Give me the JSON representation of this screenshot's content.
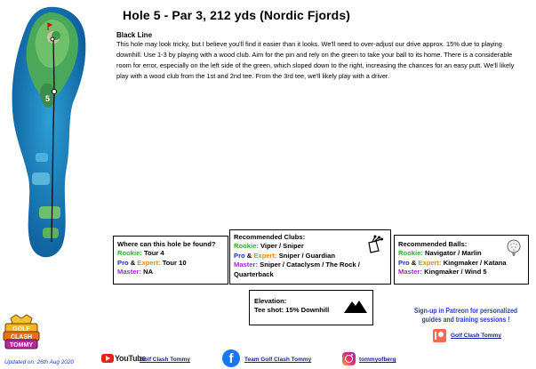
{
  "title": "Hole 5 - Par 3, 212 yds (Nordic Fjords)",
  "line_name": "Black Line",
  "description": "This hole may look tricky, but I believe you'll find it easier than it looks. We'll need to over-adjust our drive approx. 15% due to playing downhill. Use 1-3 by playing with a wood club. Aim for the pin and rely on the green to take your ball to its home. There is a considerable room for error, especially on the left side of the green, which sloped down to the right, increasing the chances for an easy putt. We'll likely play with a wood club from the 1st and 2nd tee. From the 3rd tee, we'll likely play with a driver.",
  "where": {
    "heading": "Where can this hole be found?",
    "rookie_label": "Rookie:",
    "rookie_value": "Tour 4",
    "pro_label": "Pro",
    "and_text": "&",
    "expert_label": "Expert:",
    "pro_expert_value": "Tour 10",
    "master_label": "Master:",
    "master_value": "NA"
  },
  "clubs": {
    "heading": "Recommended Clubs:",
    "rookie_label": "Rookie:",
    "rookie_value": "Viper / Sniper",
    "pro_label": "Pro",
    "and_text": "&",
    "expert_label": "Expert:",
    "pro_expert_value": "Sniper / Guardian",
    "master_label": "Master:",
    "master_value": "Sniper / Cataclysm / The Rock / Quarterback",
    "icon": "golf-bag-icon"
  },
  "balls": {
    "heading": "Recommended Balls:",
    "rookie_label": "Rookie:",
    "rookie_value": "Navigator / Marlin",
    "pro_label": "Pro",
    "and_text": "&",
    "expert_label": "Expert:",
    "pro_expert_value": "Kingmaker / Katana",
    "master_label": "Master:",
    "master_value": "Kingmaker / Wind 5",
    "icon": "golf-ball-icon"
  },
  "elevation": {
    "heading": "Elevation:",
    "value": "Tee shot: 15% Downhill",
    "icon": "mountain-icon"
  },
  "patreon": {
    "text": "Sign-up in Patreon for personalized guides and training sessions !",
    "link": "Golf Clash Tommy"
  },
  "logo_text": "GOLF CLASH TOMMY",
  "updated": "Updated on: 26th Aug 2020",
  "social": {
    "youtube_word": "YouTube",
    "youtube_link": "Golf Clash Tommy",
    "facebook_link": "Team Golf Clash Tommy",
    "instagram_link": "tommyofberg"
  },
  "colors": {
    "rookie": "#33a63a",
    "pro": "#1e2ed6",
    "expert": "#e38a12",
    "master": "#9b2bd6",
    "patreon": "#f96854",
    "youtube": "#e62117",
    "facebook": "#1877f2"
  }
}
